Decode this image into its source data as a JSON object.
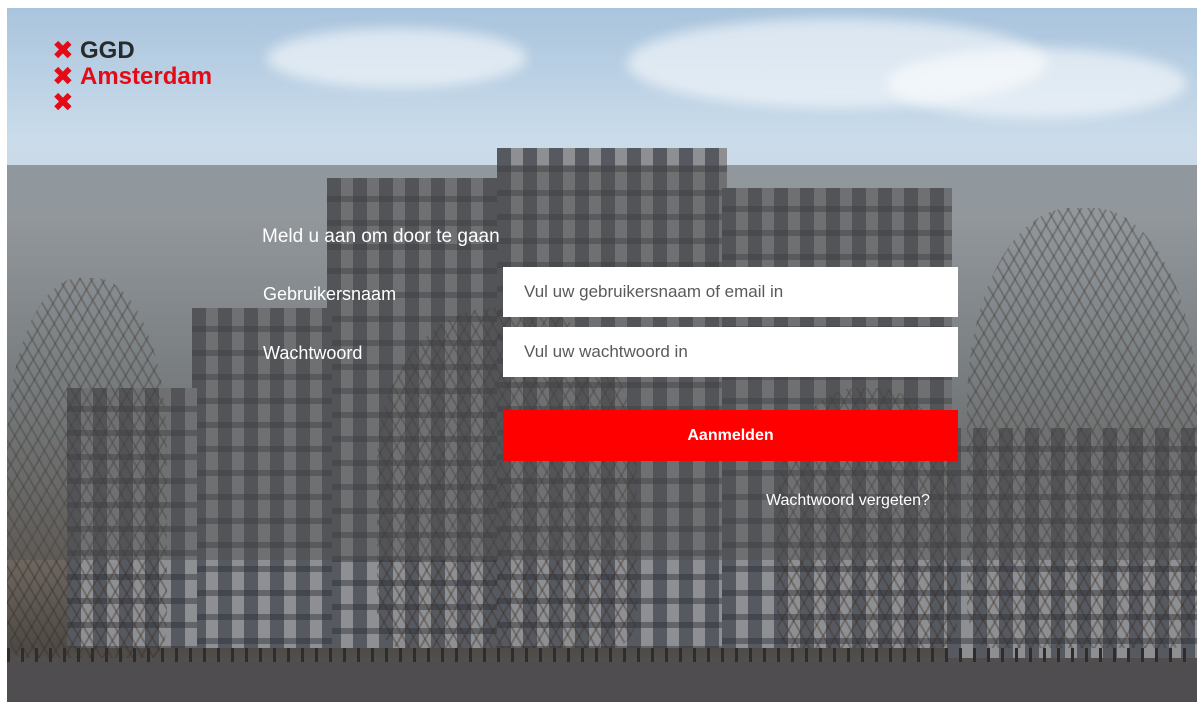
{
  "logo": {
    "line1": "GGD",
    "line2": "Amsterdam",
    "icon": "x-cross-icon",
    "brand_color": "#e30b17"
  },
  "login": {
    "heading": "Meld u aan om door te gaan",
    "username_label": "Gebruikersnaam",
    "username_placeholder": "Vul uw gebruikersnaam of email in",
    "password_label": "Wachtwoord",
    "password_placeholder": "Vul uw wachtwoord in",
    "submit_label": "Aanmelden",
    "forgot_link": "Wachtwoord vergeten?"
  },
  "colors": {
    "button": "#ff0000",
    "overlay": "rgba(80,80,80,0.48)"
  }
}
